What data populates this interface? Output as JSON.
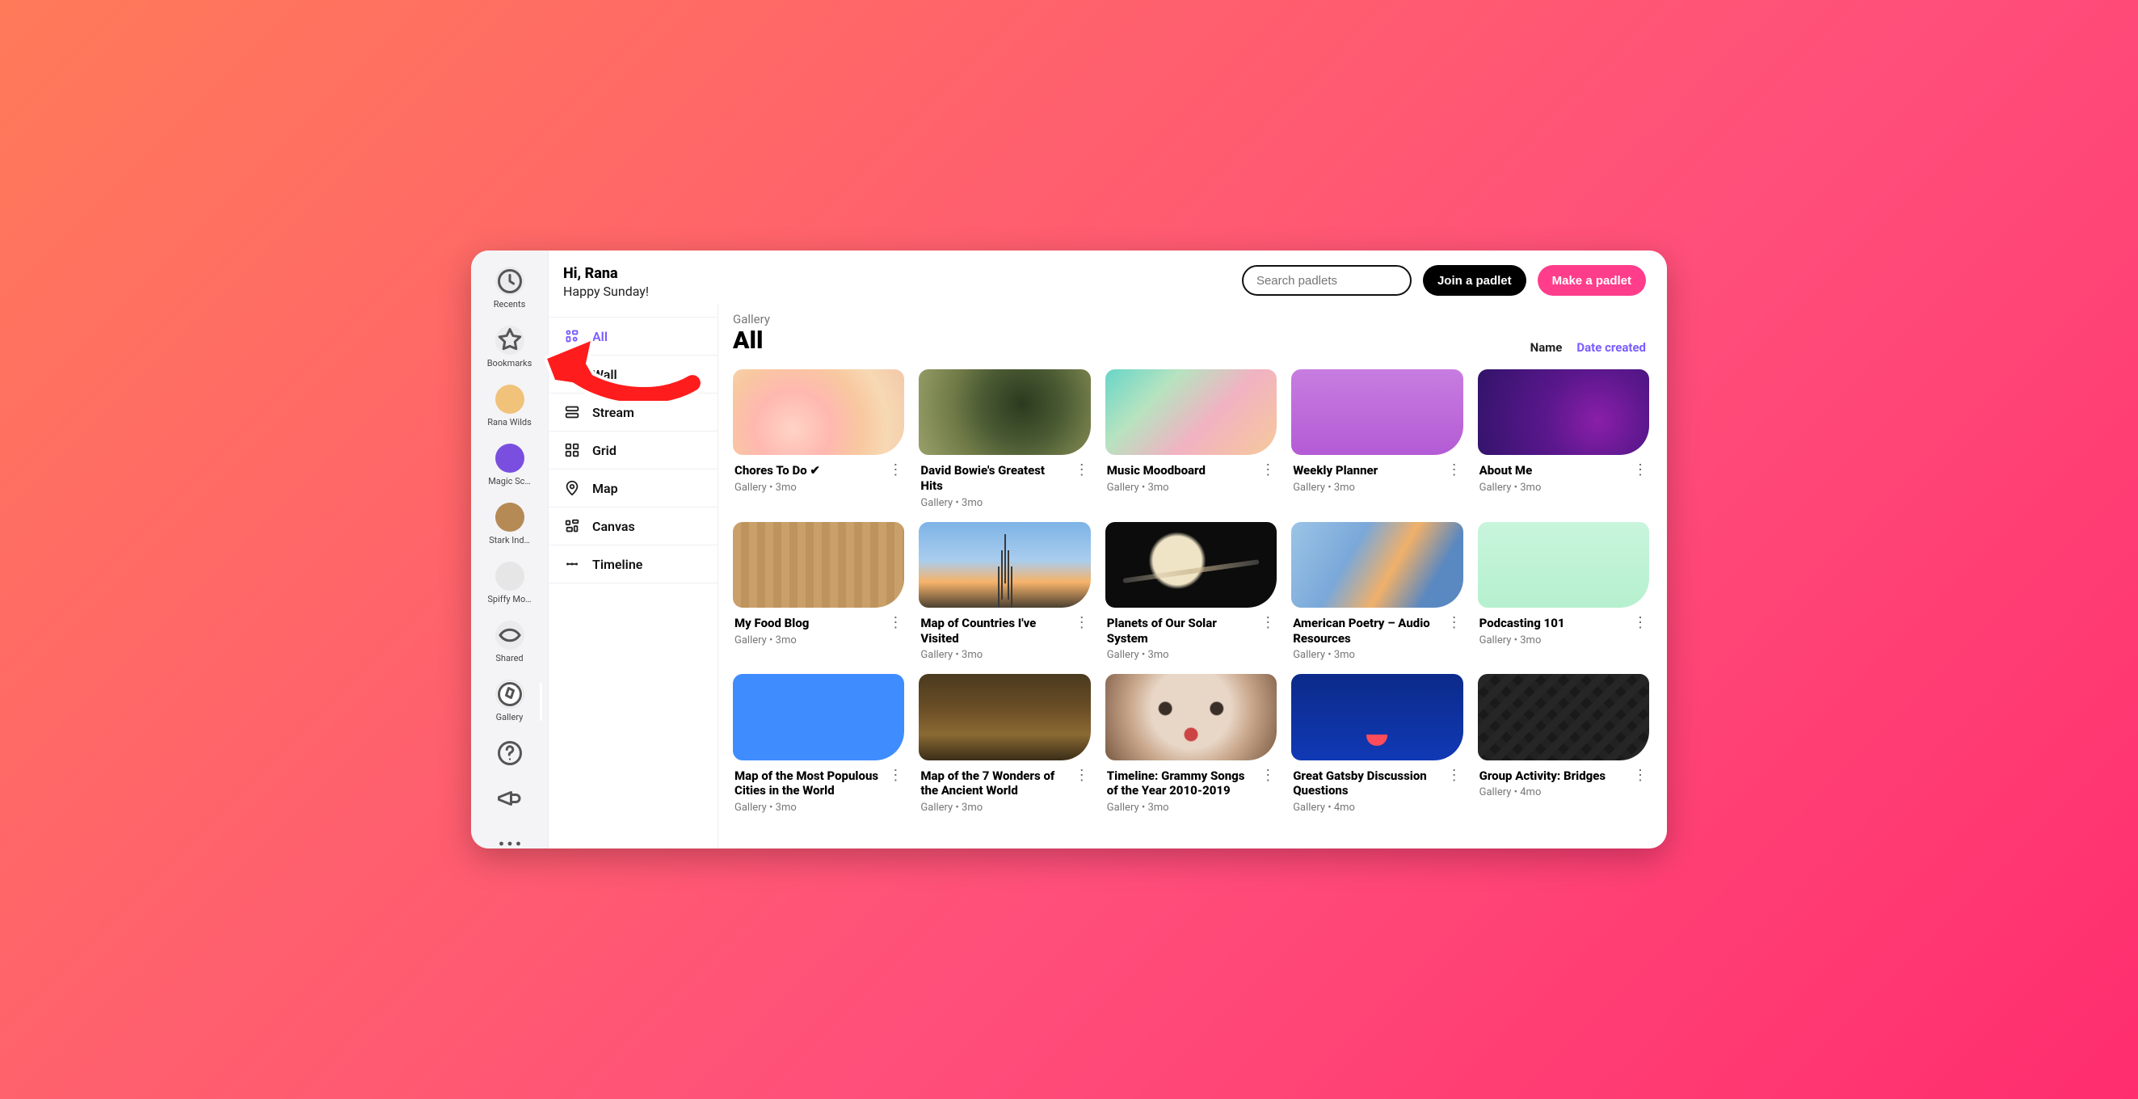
{
  "greeting": {
    "hi": "Hi, Rana",
    "sub": "Happy Sunday!"
  },
  "topbar": {
    "search_placeholder": "Search padlets",
    "join_label": "Join a padlet",
    "make_label": "Make a padlet"
  },
  "rail": {
    "items": [
      {
        "key": "recents",
        "label": "Recents",
        "icon": "clock"
      },
      {
        "key": "bookmarks",
        "label": "Bookmarks",
        "icon": "star"
      },
      {
        "key": "rana",
        "label": "Rana Wilds",
        "icon": "avatar",
        "avatar_bg": "#f0c27a"
      },
      {
        "key": "magic",
        "label": "Magic Sc…",
        "icon": "avatar",
        "avatar_bg": "#7a4fe0"
      },
      {
        "key": "stark",
        "label": "Stark Ind…",
        "icon": "avatar",
        "avatar_bg": "#b58a55"
      },
      {
        "key": "spiffy",
        "label": "Spiffy Mo…",
        "icon": "avatar",
        "avatar_bg": "#e6e6e6"
      },
      {
        "key": "shared",
        "label": "Shared",
        "icon": "share"
      },
      {
        "key": "gallery",
        "label": "Gallery",
        "icon": "compass",
        "active": true
      }
    ],
    "extra": [
      {
        "key": "help",
        "icon": "help"
      },
      {
        "key": "announce",
        "icon": "megaphone"
      },
      {
        "key": "more",
        "icon": "dots"
      }
    ]
  },
  "sidebar": {
    "items": [
      {
        "key": "all",
        "label": "All",
        "icon": "apps",
        "active": true
      },
      {
        "key": "wall",
        "label": "Wall",
        "icon": "wall"
      },
      {
        "key": "stream",
        "label": "Stream",
        "icon": "rows"
      },
      {
        "key": "grid",
        "label": "Grid",
        "icon": "grid"
      },
      {
        "key": "map",
        "label": "Map",
        "icon": "pin"
      },
      {
        "key": "canvas",
        "label": "Canvas",
        "icon": "canvas"
      },
      {
        "key": "timeline",
        "label": "Timeline",
        "icon": "timeline"
      }
    ]
  },
  "content": {
    "breadcrumb": "Gallery",
    "heading": "All",
    "sort": {
      "name_label": "Name",
      "date_label": "Date created",
      "active": "date"
    },
    "cards": [
      {
        "title": "Chores To Do ✔",
        "type": "Gallery",
        "age": "3mo",
        "bg": "bg-flower"
      },
      {
        "title": "David Bowie's Greatest Hits",
        "type": "Gallery",
        "age": "3mo",
        "bg": "bg-olive"
      },
      {
        "title": "Music Moodboard",
        "type": "Gallery",
        "age": "3mo",
        "bg": "bg-pastel"
      },
      {
        "title": "Weekly Planner",
        "type": "Gallery",
        "age": "3mo",
        "bg": "bg-purple"
      },
      {
        "title": "About Me",
        "type": "Gallery",
        "age": "3mo",
        "bg": "bg-deep"
      },
      {
        "title": "My Food Blog",
        "type": "Gallery",
        "age": "3mo",
        "bg": "bg-wood"
      },
      {
        "title": "Map of Countries I've Visited",
        "type": "Gallery",
        "age": "3mo",
        "bg": "bg-eiffel"
      },
      {
        "title": "Planets of Our Solar System",
        "type": "Gallery",
        "age": "3mo",
        "bg": "bg-saturn"
      },
      {
        "title": "American Poetry – Audio Resources",
        "type": "Gallery",
        "age": "3mo",
        "bg": "bg-blue"
      },
      {
        "title": "Podcasting 101",
        "type": "Gallery",
        "age": "3mo",
        "bg": "bg-mint"
      },
      {
        "title": "Map of the Most Populous Cities in the World",
        "type": "Gallery",
        "age": "3mo",
        "bg": "bg-solidb"
      },
      {
        "title": "Map of the 7 Wonders of the Ancient World",
        "type": "Gallery",
        "age": "3mo",
        "bg": "bg-hall"
      },
      {
        "title": "Timeline: Grammy Songs of the Year 2010-2019",
        "type": "Gallery",
        "age": "3mo",
        "bg": "bg-face"
      },
      {
        "title": "Great Gatsby Discussion Questions",
        "type": "Gallery",
        "age": "4mo",
        "bg": "bg-royal"
      },
      {
        "title": "Group Activity: Bridges",
        "type": "Gallery",
        "age": "4mo",
        "bg": "bg-roads"
      }
    ]
  }
}
